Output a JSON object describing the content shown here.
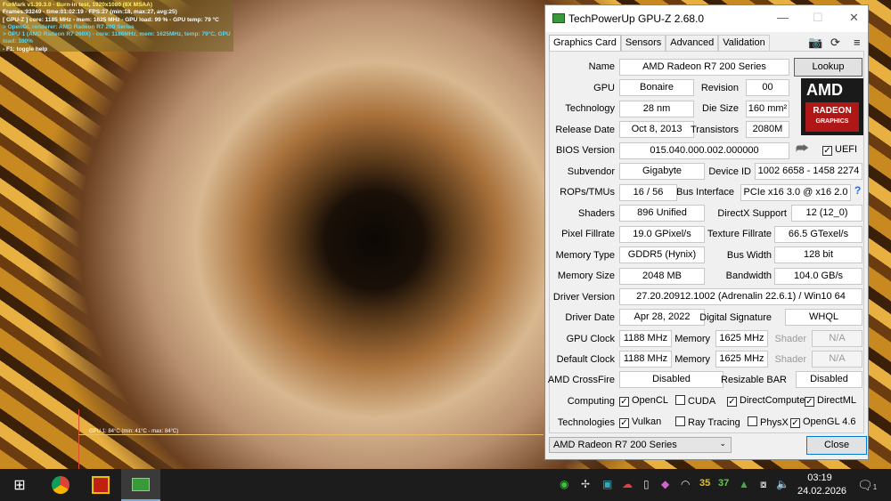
{
  "furmark": {
    "lines": [
      "FurMark v1.39.3.0 - Burn-in test, 1920x1080 (8X MSAA)",
      "Frames:93249 - time:01:02:19 - FPS:27 (min:18, max:27, avg:25)",
      "[ GPU-Z ] core: 1185 MHz - mem: 1625 MHz - GPU load: 99 % - GPU temp: 79 °C",
      "> OpenGL renderer: AMD Radeon R7 200 Series",
      "> GPU 1 (AMD Radeon R7 260X) - core: 1186MHz, mem: 1625MHz, temp: 79°C, GPU load: 100%",
      "- F1: toggle help"
    ],
    "graph_label": "GPU 1: 84°C (min: 41°C - max: 84°C)"
  },
  "gpuz": {
    "title": "TechPowerUp GPU-Z 2.68.0",
    "tabs": [
      "Graphics Card",
      "Sensors",
      "Advanced",
      "Validation"
    ],
    "name_label": "Name",
    "name": "AMD Radeon R7 200 Series",
    "lookup": "Lookup",
    "gpu_label": "GPU",
    "gpu": "Bonaire",
    "revision_label": "Revision",
    "revision": "00",
    "tech_label": "Technology",
    "tech": "28 nm",
    "die_label": "Die Size",
    "die": "160 mm²",
    "release_label": "Release Date",
    "release": "Oct 8, 2013",
    "trans_label": "Transistors",
    "trans": "2080M",
    "bios_label": "BIOS Version",
    "bios": "015.040.000.002.000000",
    "uefi": "UEFI",
    "subvendor_label": "Subvendor",
    "subvendor": "Gigabyte",
    "devid_label": "Device ID",
    "devid": "1002 6658 - 1458 2274",
    "rops_label": "ROPs/TMUs",
    "rops": "16 / 56",
    "bus_label": "Bus Interface",
    "bus": "PCIe x16 3.0 @ x16 2.0",
    "help": "?",
    "shaders_label": "Shaders",
    "shaders": "896 Unified",
    "dx_label": "DirectX Support",
    "dx": "12 (12_0)",
    "pix_label": "Pixel Fillrate",
    "pix": "19.0 GPixel/s",
    "tex_label": "Texture Fillrate",
    "tex": "66.5 GTexel/s",
    "memtype_label": "Memory Type",
    "memtype": "GDDR5 (Hynix)",
    "bw_label": "Bus Width",
    "bw": "128 bit",
    "memsize_label": "Memory Size",
    "memsize": "2048 MB",
    "band_label": "Bandwidth",
    "band": "104.0 GB/s",
    "drv_label": "Driver Version",
    "drv": "27.20.20912.1002 (Adrenalin 22.6.1) / Win10 64",
    "drvdate_label": "Driver Date",
    "drvdate": "Apr 28, 2022",
    "sig_label": "Digital Signature",
    "sig": "WHQL",
    "gpuclk_label": "GPU Clock",
    "gpuclk": "1188 MHz",
    "mem_label": "Memory",
    "gpumem": "1625 MHz",
    "shader_label": "Shader",
    "na": "N/A",
    "defclk_label": "Default Clock",
    "defclk": "1188 MHz",
    "defmem": "1625 MHz",
    "cf_label": "AMD CrossFire",
    "cf": "Disabled",
    "rbar_label": "Resizable BAR",
    "rbar": "Disabled",
    "computing_label": "Computing",
    "computing": [
      {
        "l": "OpenCL",
        "c": true
      },
      {
        "l": "CUDA",
        "c": false
      },
      {
        "l": "DirectCompute",
        "c": true
      },
      {
        "l": "DirectML",
        "c": true
      }
    ],
    "tech2_label": "Technologies",
    "technologies": [
      {
        "l": "Vulkan",
        "c": true
      },
      {
        "l": "Ray Tracing",
        "c": false
      },
      {
        "l": "PhysX",
        "c": false
      },
      {
        "l": "OpenGL 4.6",
        "c": true
      }
    ],
    "logo": {
      "brand": "AMD",
      "line1": "RADEON",
      "line2": "GRAPHICS"
    },
    "select": "AMD Radeon R7 200 Series",
    "close": "Close"
  },
  "taskbar": {
    "temp1": "35",
    "temp2": "37",
    "time": "03:19",
    "date": "24.02.2026",
    "notif": "1"
  }
}
